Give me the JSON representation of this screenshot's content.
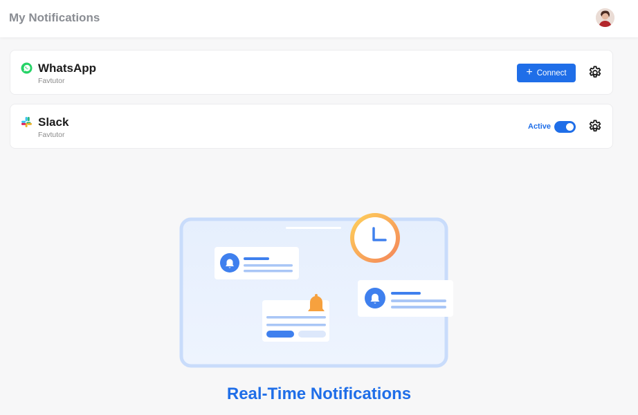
{
  "header": {
    "title": "My Notifications"
  },
  "integrations": [
    {
      "name": "WhatsApp",
      "subtitle": "Favtutor",
      "action_label": "Connect",
      "action_icon": "plus-icon"
    },
    {
      "name": "Slack",
      "subtitle": "Favtutor",
      "status_label": "Active",
      "toggle_on": true
    }
  ],
  "hero": {
    "title": "Real-Time Notifications"
  },
  "colors": {
    "accent": "#1f6ee8",
    "whatsapp": "#25d366",
    "illustration_frame": "#cfe0fb",
    "clock_ring": "#f7b24f"
  }
}
